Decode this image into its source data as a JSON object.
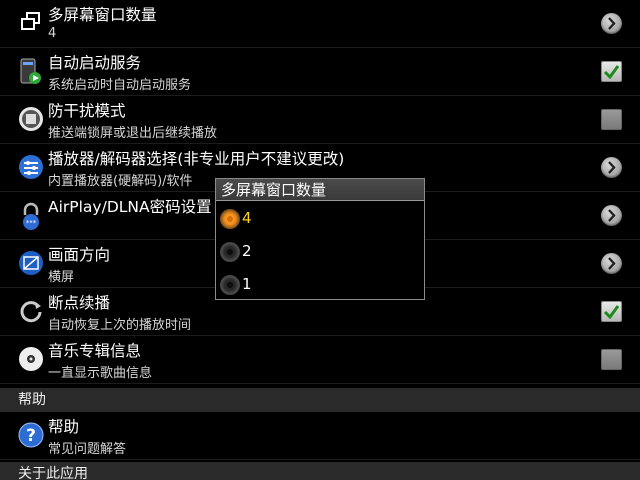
{
  "settings": [
    {
      "title": "多屏幕窗口数量",
      "subtitle": "4",
      "control": "arrow",
      "icon": "multi-window-icon"
    },
    {
      "title": "自动启动服务",
      "subtitle": "系统启动时自动启动服务",
      "control": "checkbox",
      "checked": true,
      "icon": "autostart-icon"
    },
    {
      "title": "防干扰模式",
      "subtitle": "推送端锁屏或退出后继续播放",
      "control": "checkbox",
      "checked": false,
      "icon": "anti-interference-icon"
    },
    {
      "title": "播放器/解码器选择(非专业用户不建议更改)",
      "subtitle": "内置播放器(硬解码)/软件",
      "control": "arrow",
      "icon": "player-decoder-icon"
    },
    {
      "title": "AirPlay/DLNA密码设置",
      "subtitle": "",
      "control": "arrow",
      "icon": "lock-icon"
    },
    {
      "title": "画面方向",
      "subtitle": "横屏",
      "control": "arrow",
      "icon": "orientation-icon"
    },
    {
      "title": "断点续播",
      "subtitle": "自动恢复上次的播放时间",
      "control": "checkbox",
      "checked": true,
      "icon": "resume-icon"
    },
    {
      "title": "音乐专辑信息",
      "subtitle": "一直显示歌曲信息",
      "control": "checkbox",
      "checked": false,
      "icon": "album-icon"
    }
  ],
  "help_header": "帮助",
  "help_item": {
    "title": "帮助",
    "subtitle": "常见问题解答",
    "icon": "help-icon"
  },
  "about_header": "关于此应用",
  "dialog": {
    "title": "多屏幕窗口数量",
    "options": [
      "4",
      "2",
      "1"
    ],
    "selected": "4"
  },
  "colors": {
    "checkmark": "#1a8c1a",
    "radio_selected": "#f08a1a",
    "selected_label": "#ffd21a"
  }
}
